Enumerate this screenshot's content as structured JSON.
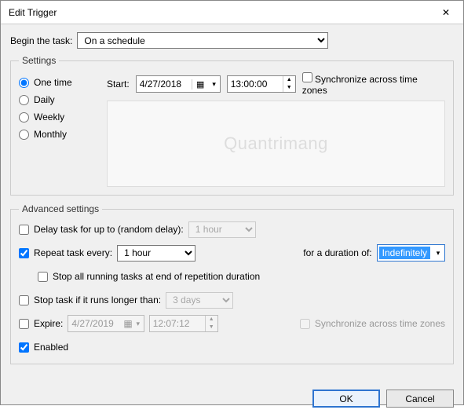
{
  "window": {
    "title": "Edit Trigger"
  },
  "begin": {
    "label": "Begin the task:",
    "value": "On a schedule"
  },
  "settings": {
    "legend": "Settings",
    "schedule": {
      "one_time": "One time",
      "daily": "Daily",
      "weekly": "Weekly",
      "monthly": "Monthly",
      "selected": "one_time"
    },
    "start_label": "Start:",
    "date": "4/27/2018",
    "time": "13:00:00",
    "sync_label": "Synchronize across time zones"
  },
  "advanced": {
    "legend": "Advanced settings",
    "delay_label": "Delay task for up to (random delay):",
    "delay_value": "1 hour",
    "repeat_label": "Repeat task every:",
    "repeat_value": "1 hour",
    "duration_label": "for a duration of:",
    "duration_value": "Indefinitely",
    "stop_all_label": "Stop all running tasks at end of repetition duration",
    "stop_if_label": "Stop task if it runs longer than:",
    "stop_if_value": "3 days",
    "expire_label": "Expire:",
    "expire_date": "4/27/2019",
    "expire_time": "12:07:12",
    "sync2_label": "Synchronize across time zones",
    "enabled_label": "Enabled"
  },
  "buttons": {
    "ok": "OK",
    "cancel": "Cancel"
  },
  "watermark": "Quantrimang"
}
